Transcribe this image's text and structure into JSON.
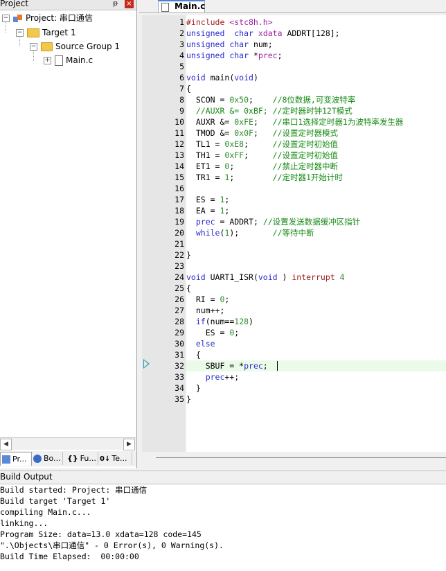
{
  "project_pane": {
    "title": "Project",
    "pin_glyph": "ᵽ",
    "close_glyph": "×",
    "tree": {
      "project": "Project: 串口通信",
      "target": "Target 1",
      "group": "Source Group 1",
      "file": "Main.c"
    },
    "tabs": [
      {
        "label": "Pr...",
        "icon": "project-icon"
      },
      {
        "label": "Bo...",
        "icon": "books-icon"
      },
      {
        "label": "Fu...",
        "icon": "functions-icon",
        "glyph": "{}"
      },
      {
        "label": "Te...",
        "icon": "templates-icon",
        "glyph": "0↓"
      }
    ]
  },
  "editor": {
    "tab_label": "Main.c",
    "line_numbers": [
      "1",
      "2",
      "3",
      "4",
      "5",
      "6",
      "7",
      "8",
      "9",
      "10",
      "11",
      "12",
      "13",
      "14",
      "15",
      "16",
      "17",
      "18",
      "19",
      "20",
      "21",
      "22",
      "23",
      "24",
      "25",
      "26",
      "27",
      "28",
      "29",
      "30",
      "31",
      "32",
      "33",
      "34",
      "35"
    ],
    "current_line": 32,
    "lines": [
      [
        [
          "pp",
          "#include "
        ],
        [
          "str",
          "<stc8h.h>"
        ]
      ],
      [
        [
          "kw",
          "unsigned"
        ],
        [
          "",
          "  "
        ],
        [
          "kw",
          "char"
        ],
        [
          "",
          " "
        ],
        [
          "str",
          "xdata"
        ],
        [
          "",
          " ADDRT[128];"
        ]
      ],
      [
        [
          "kw",
          "unsigned"
        ],
        [
          "",
          " "
        ],
        [
          "kw",
          "char"
        ],
        [
          "",
          " num;"
        ]
      ],
      [
        [
          "kw",
          "unsigned"
        ],
        [
          "",
          " "
        ],
        [
          "kw",
          "char"
        ],
        [
          "",
          " *"
        ],
        [
          "str",
          "prec"
        ],
        [
          "",
          ";"
        ]
      ],
      [],
      [
        [
          "kw",
          "void"
        ],
        [
          "",
          " main("
        ],
        [
          "kw",
          "void"
        ],
        [
          "",
          ")"
        ]
      ],
      [
        [
          "",
          "{"
        ]
      ],
      [
        [
          "",
          "  SCON = "
        ],
        [
          "num",
          "0x50"
        ],
        [
          "",
          ";    "
        ],
        [
          "cmt",
          "//8位数据,可变波特率"
        ]
      ],
      [
        [
          "",
          "  "
        ],
        [
          "cmt",
          "//AUXR &= 0xBF; //定时器时钟12T模式"
        ]
      ],
      [
        [
          "",
          "  AUXR &= "
        ],
        [
          "num",
          "0xFE"
        ],
        [
          "",
          ";   "
        ],
        [
          "cmt",
          "//串口1选择定时器1为波特率发生器"
        ]
      ],
      [
        [
          "",
          "  TMOD &= "
        ],
        [
          "num",
          "0x0F"
        ],
        [
          "",
          ";   "
        ],
        [
          "cmt",
          "//设置定时器模式"
        ]
      ],
      [
        [
          "",
          "  TL1 = "
        ],
        [
          "num",
          "0xE8"
        ],
        [
          "",
          ";     "
        ],
        [
          "cmt",
          "//设置定时初始值"
        ]
      ],
      [
        [
          "",
          "  TH1 = "
        ],
        [
          "num",
          "0xFF"
        ],
        [
          "",
          ";     "
        ],
        [
          "cmt",
          "//设置定时初始值"
        ]
      ],
      [
        [
          "",
          "  ET1 = "
        ],
        [
          "num",
          "0"
        ],
        [
          "",
          ";        "
        ],
        [
          "cmt",
          "//禁止定时器中断"
        ]
      ],
      [
        [
          "",
          "  TR1 = "
        ],
        [
          "num",
          "1"
        ],
        [
          "",
          ";        "
        ],
        [
          "cmt",
          "//定时器1开始计时"
        ]
      ],
      [],
      [
        [
          "",
          "  ES = "
        ],
        [
          "num",
          "1"
        ],
        [
          "",
          ";"
        ]
      ],
      [
        [
          "",
          "  EA = "
        ],
        [
          "num",
          "1"
        ],
        [
          "",
          ";"
        ]
      ],
      [
        [
          "",
          "  "
        ],
        [
          "kw",
          "prec"
        ],
        [
          "",
          " = ADDRT; "
        ],
        [
          "cmt",
          "//设置发送数据缓冲区指针"
        ]
      ],
      [
        [
          "",
          "  "
        ],
        [
          "kw",
          "while"
        ],
        [
          "",
          "("
        ],
        [
          "num",
          "1"
        ],
        [
          "",
          ");       "
        ],
        [
          "cmt",
          "//等待中断"
        ]
      ],
      [],
      [
        [
          "",
          "}"
        ]
      ],
      [],
      [
        [
          "kw",
          "void"
        ],
        [
          "",
          " UART1_ISR("
        ],
        [
          "kw",
          "void"
        ],
        [
          "",
          " ) "
        ],
        [
          "pp",
          "interrupt"
        ],
        [
          "",
          " "
        ],
        [
          "num",
          "4"
        ]
      ],
      [
        [
          "",
          "{"
        ]
      ],
      [
        [
          "",
          "  RI = "
        ],
        [
          "num",
          "0"
        ],
        [
          "",
          ";"
        ]
      ],
      [
        [
          "",
          "  num++;"
        ]
      ],
      [
        [
          "",
          "  "
        ],
        [
          "kw",
          "if"
        ],
        [
          "",
          "(num=="
        ],
        [
          "num",
          "128"
        ],
        [
          "",
          ")"
        ]
      ],
      [
        [
          "",
          "    ES = "
        ],
        [
          "num",
          "0"
        ],
        [
          "",
          ";"
        ]
      ],
      [
        [
          "",
          "  "
        ],
        [
          "kw",
          "else"
        ]
      ],
      [
        [
          "",
          "  {"
        ]
      ],
      [
        [
          "",
          "    SBUF = *"
        ],
        [
          "kw",
          "prec"
        ],
        [
          "",
          ";"
        ]
      ],
      [
        [
          "",
          "    "
        ],
        [
          "kw",
          "prec"
        ],
        [
          "",
          "++;"
        ]
      ],
      [
        [
          "",
          "  }"
        ]
      ],
      [
        [
          "",
          "}"
        ]
      ]
    ]
  },
  "build_output": {
    "title": "Build Output",
    "lines": [
      "Build started: Project: 串口通信",
      "Build target 'Target 1'",
      "compiling Main.c...",
      "linking...",
      "Program Size: data=13.0 xdata=128 code=145",
      "\".\\Objects\\串口通信\" - 0 Error(s), 0 Warning(s).",
      "Build Time Elapsed:  00:00:00"
    ]
  }
}
